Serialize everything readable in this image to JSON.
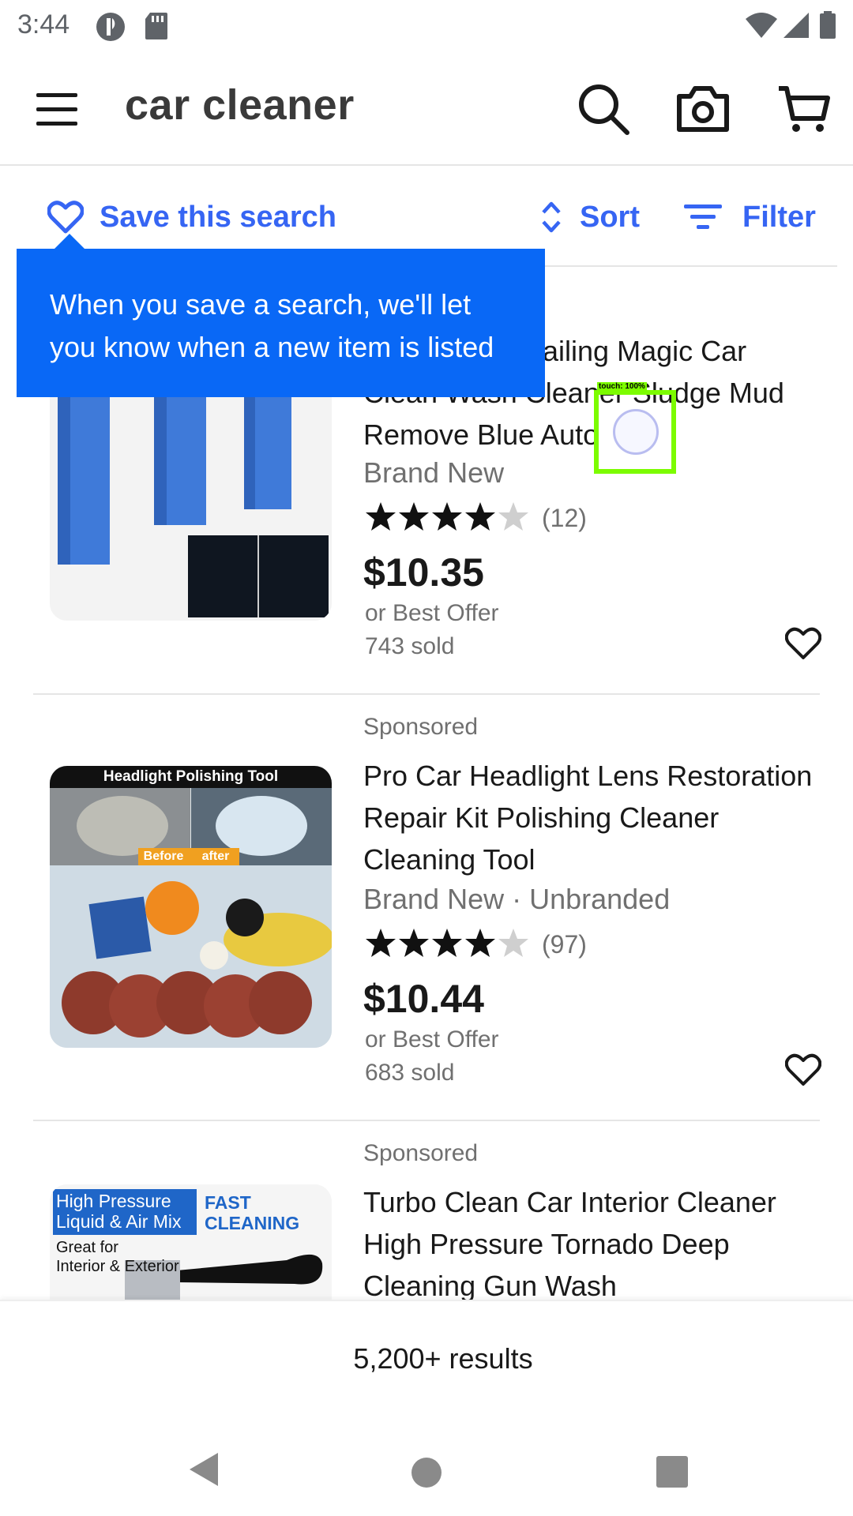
{
  "status_bar": {
    "time": "3:44",
    "icons": [
      "app-notification-icon",
      "sd-card-icon",
      "wifi-icon",
      "cell-signal-icon",
      "battery-icon"
    ]
  },
  "app_bar": {
    "search_query": "car cleaner",
    "icons": [
      "menu-icon",
      "search-icon",
      "camera-icon",
      "cart-icon"
    ]
  },
  "filter_row": {
    "save_search_label": "Save this search",
    "sort_label": "Sort",
    "filter_label": "Filter"
  },
  "tooltip": {
    "line1": "When you save a search, we'll let",
    "line2": "you know when a new item is listed"
  },
  "listings": [
    {
      "title_lines": [
        "etailing Magic Car",
        "Clean Wash Cleaner Sludge Mud",
        "Remove Blue Auto"
      ],
      "condition": "Brand New",
      "rating": 4,
      "rating_count": "(12)",
      "price": "$10.35",
      "offer": "or Best Offer",
      "sold": "743 sold"
    },
    {
      "sponsored": "Sponsored",
      "title_lines": [
        "Pro Car Headlight Lens Restoration",
        "Repair Kit Polishing Cleaner",
        "Cleaning Tool"
      ],
      "condition": "Brand New · Unbranded",
      "rating": 4,
      "rating_count": "(97)",
      "price": "$10.44",
      "offer": "or Best Offer",
      "sold": "683 sold",
      "image_text": {
        "banner": "Headlight Polishing Tool",
        "before": "Before",
        "after": "after"
      }
    },
    {
      "sponsored": "Sponsored",
      "title_lines": [
        "Turbo Clean Car Interior Cleaner",
        "High Pressure Tornado Deep",
        "Cleaning Gun Wash"
      ],
      "image_text": {
        "tag1": "High Pressure",
        "tag2": "Liquid & Air Mix",
        "fast": "FAST",
        "cleaning": "CLEANING",
        "great1": "Great for",
        "great2": "Interior & Exterior"
      }
    }
  ],
  "results": {
    "count_text": "5,200+ results"
  },
  "touch_indicator": {
    "label": "touch: 100%"
  },
  "colors": {
    "accent_blue": "#3665f3",
    "tooltip_blue": "#0968f6",
    "touch_green": "#7cfc00"
  }
}
